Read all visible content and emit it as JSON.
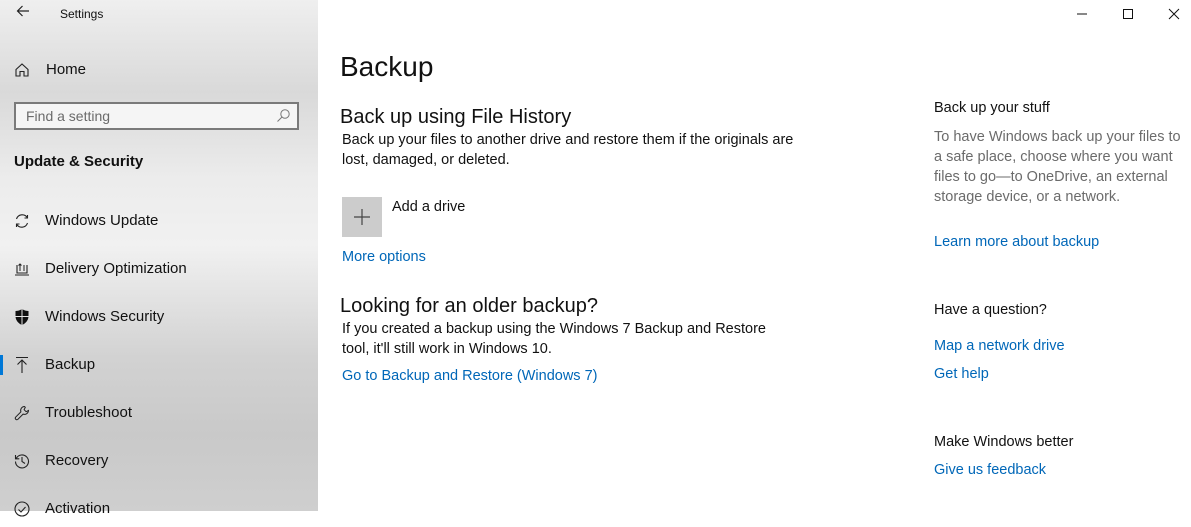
{
  "window": {
    "title": "Settings",
    "controls": {
      "minimize": "minimize",
      "maximize": "maximize",
      "close": "close"
    }
  },
  "sidebar": {
    "home_label": "Home",
    "search": {
      "placeholder": "Find a setting",
      "value": ""
    },
    "section_heading": "Update & Security",
    "items": [
      {
        "label": "Windows Update",
        "icon": "refresh-icon",
        "active": false
      },
      {
        "label": "Delivery Optimization",
        "icon": "delivery-optimization-icon",
        "active": false
      },
      {
        "label": "Windows Security",
        "icon": "shield-icon",
        "active": false
      },
      {
        "label": "Backup",
        "icon": "backup-arrow-icon",
        "active": true
      },
      {
        "label": "Troubleshoot",
        "icon": "wrench-icon",
        "active": false
      },
      {
        "label": "Recovery",
        "icon": "history-icon",
        "active": false
      },
      {
        "label": "Activation",
        "icon": "check-circle-icon",
        "active": false
      }
    ],
    "accent_color": "#0078d7"
  },
  "main": {
    "page_title": "Backup",
    "file_history": {
      "heading": "Back up using File History",
      "description": "Back up your files to another drive and restore them if the originals are lost, damaged, or deleted.",
      "add_drive_label": "Add a drive",
      "more_options_link": "More options"
    },
    "older_backup": {
      "heading": "Looking for an older backup?",
      "description": "If you created a backup using the Windows 7 Backup and Restore tool, it'll still work in Windows 10.",
      "link": "Go to Backup and Restore (Windows 7)"
    },
    "link_color": "#0067b8"
  },
  "related": {
    "backup_stuff": {
      "heading": "Back up your stuff",
      "description": "To have Windows back up your files to a safe place, choose where you want files to go—to OneDrive, an external storage device, or a network.",
      "link": "Learn more about backup"
    },
    "question": {
      "heading": "Have a question?",
      "links": [
        "Map a network drive",
        "Get help"
      ]
    },
    "feedback": {
      "heading": "Make Windows better",
      "link": "Give us feedback"
    }
  }
}
